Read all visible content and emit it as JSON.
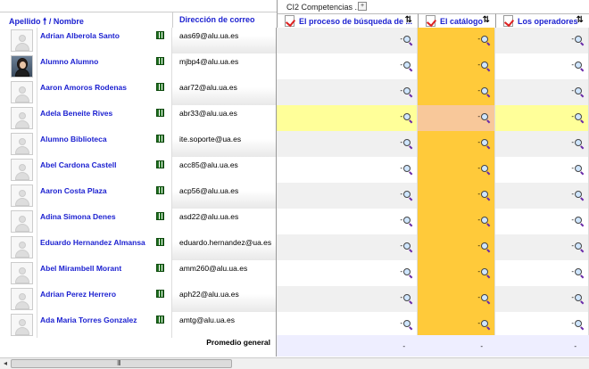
{
  "header": {
    "sort_surname": "Apellido",
    "sort_separator": "/",
    "sort_name": "Nombre",
    "email_col": "Dirección de correo"
  },
  "category": {
    "label": "CI2 Competencias ...",
    "toggle": "+"
  },
  "items": [
    {
      "label": "El proceso de búsqueda de ...",
      "sort": "⇅"
    },
    {
      "label": "El catálogo",
      "sort": "⇅"
    },
    {
      "label": "Los operadores",
      "sort": "⇅"
    }
  ],
  "icons": {
    "sort_arrow": "up-arrow-icon",
    "user_grid": "grid-report-icon",
    "magnifier": "magnifier-icon",
    "checkbox": "checkbox-icon"
  },
  "colors": {
    "link": "#1a1fd0",
    "highlight_yellow": "#ffff99",
    "highlight_orange": "#f8c89a",
    "column_orange": "#ffca3a",
    "average_bg": "#eeeeff"
  },
  "students": [
    {
      "name": "Adrian Alberola Santo",
      "email": "aas69@alu.ua.es",
      "grades": [
        "-",
        "-",
        "-"
      ]
    },
    {
      "name": "Alumno Alumno",
      "email": "mjbp4@alu.ua.es",
      "grades": [
        "-",
        "-",
        "-"
      ]
    },
    {
      "name": "Aaron Amoros Rodenas",
      "email": "aar72@alu.ua.es",
      "grades": [
        "-",
        "-",
        "-"
      ]
    },
    {
      "name": "Adela Beneite Rives",
      "email": "abr33@alu.ua.es",
      "grades": [
        "-",
        "-",
        "-"
      ]
    },
    {
      "name": "Alumno Biblioteca",
      "email": "ite.soporte@ua.es",
      "grades": [
        "-",
        "-",
        "-"
      ]
    },
    {
      "name": "Abel Cardona Castell",
      "email": "acc85@alu.ua.es",
      "grades": [
        "-",
        "-",
        "-"
      ]
    },
    {
      "name": "Aaron Costa Plaza",
      "email": "acp56@alu.ua.es",
      "grades": [
        "-",
        "-",
        "-"
      ]
    },
    {
      "name": "Adina Simona Denes",
      "email": "asd22@alu.ua.es",
      "grades": [
        "-",
        "-",
        "-"
      ]
    },
    {
      "name": "Eduardo Hernandez Almansa",
      "email": "eduardo.hernandez@ua.es",
      "grades": [
        "-",
        "-",
        "-"
      ]
    },
    {
      "name": "Abel Mirambell Morant",
      "email": "amm260@alu.ua.es",
      "grades": [
        "-",
        "-",
        "-"
      ]
    },
    {
      "name": "Adrian Perez Herrero",
      "email": "aph22@alu.ua.es",
      "grades": [
        "-",
        "-",
        "-"
      ]
    },
    {
      "name": "Ada Maria Torres Gonzalez",
      "email": "amtg@alu.ua.es",
      "grades": [
        "-",
        "-",
        "-"
      ]
    }
  ],
  "average": {
    "label": "Promedio general",
    "values": [
      "-",
      "-",
      "-"
    ]
  },
  "scrollbar": {
    "grip": "III"
  }
}
